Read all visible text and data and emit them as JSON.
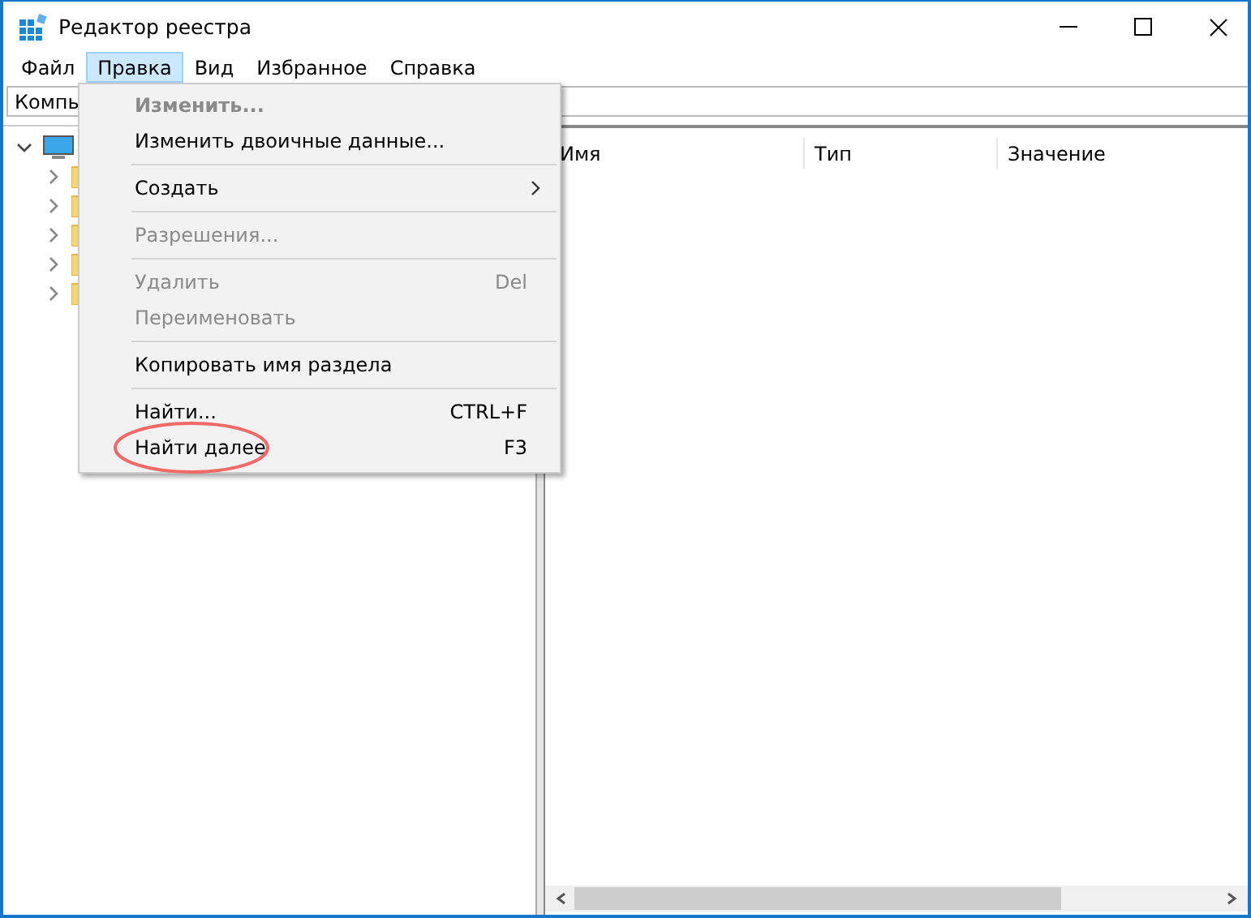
{
  "window": {
    "title": "Редактор реестра"
  },
  "menubar": [
    {
      "label": "Файл",
      "selected": false
    },
    {
      "label": "Правка",
      "selected": true
    },
    {
      "label": "Вид",
      "selected": false
    },
    {
      "label": "Избранное",
      "selected": false
    },
    {
      "label": "Справка",
      "selected": false
    }
  ],
  "address": {
    "value": "Компь"
  },
  "tree": {
    "root": {
      "expanded": true,
      "children": [
        {
          "expanded": false
        },
        {
          "expanded": false
        },
        {
          "expanded": false
        },
        {
          "expanded": false
        },
        {
          "expanded": false
        }
      ]
    }
  },
  "columns": [
    "Имя",
    "Тип",
    "Значение"
  ],
  "menu": [
    {
      "kind": "item",
      "label": "Изменить...",
      "disabled": true,
      "default": true
    },
    {
      "kind": "item",
      "label": "Изменить двоичные данные...",
      "disabled": false,
      "default": false
    },
    {
      "kind": "separator"
    },
    {
      "kind": "item",
      "label": "Создать",
      "disabled": false,
      "default": false,
      "submenu": true
    },
    {
      "kind": "separator"
    },
    {
      "kind": "item",
      "label": "Разрешения...",
      "disabled": true,
      "default": false
    },
    {
      "kind": "separator"
    },
    {
      "kind": "item",
      "label": "Удалить",
      "shortcut": "Del",
      "disabled": true,
      "default": false
    },
    {
      "kind": "item",
      "label": "Переименовать",
      "disabled": true,
      "default": false
    },
    {
      "kind": "separator"
    },
    {
      "kind": "item",
      "label": "Копировать имя раздела",
      "disabled": false,
      "default": false
    },
    {
      "kind": "separator"
    },
    {
      "kind": "item",
      "label": "Найти...",
      "shortcut": "CTRL+F",
      "disabled": false,
      "default": false
    },
    {
      "kind": "item",
      "label": "Найти далее",
      "shortcut": "F3",
      "disabled": false,
      "default": false,
      "highlighted_annotation": true
    }
  ]
}
